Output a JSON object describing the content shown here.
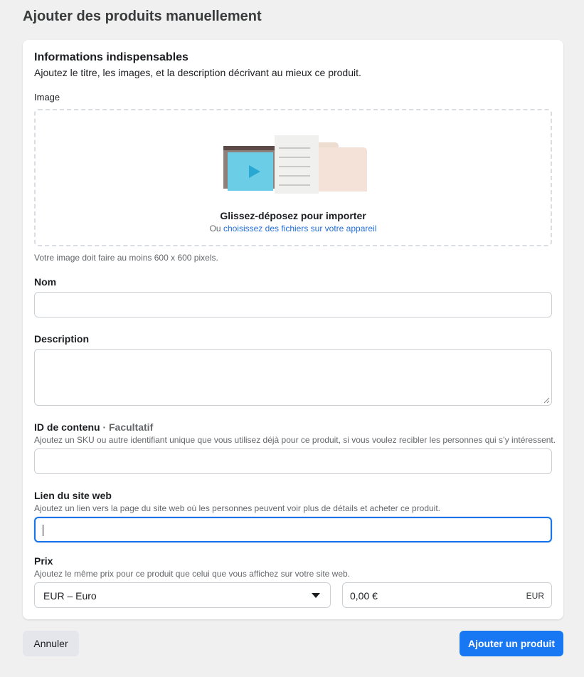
{
  "page": {
    "title": "Ajouter des produits manuellement"
  },
  "section": {
    "title": "Informations indispensables",
    "subtitle": "Ajoutez le titre, les images, et la description décrivant au mieux ce produit."
  },
  "image": {
    "label": "Image",
    "drop_title": "Glissez-déposez pour importer",
    "drop_or": "Ou",
    "drop_link": "choisissez des fichiers sur votre appareil",
    "helper": "Votre image doit faire au moins 600 x 600 pixels.",
    "illustration_icon": "media-files-illustration"
  },
  "name": {
    "label": "Nom",
    "value": "",
    "placeholder": ""
  },
  "description": {
    "label": "Description",
    "value": ""
  },
  "content_id": {
    "label": "ID de contenu",
    "optional": "· Facultatif",
    "helper": "Ajoutez un SKU ou autre identifiant unique que vous utilisez déjà pour ce produit, si vous voulez recibler les personnes qui s’y intéressent.",
    "value": ""
  },
  "website": {
    "label": "Lien du site web",
    "helper": "Ajoutez un lien vers la page du site web où les personnes peuvent voir plus de détails et acheter ce produit.",
    "value": "",
    "focused": true
  },
  "price": {
    "label": "Prix",
    "helper": "Ajoutez le même prix pour ce produit que celui que vous affichez sur votre site web.",
    "currency_selected": "EUR – Euro",
    "amount": "0,00 €",
    "unit": "EUR"
  },
  "actions": {
    "cancel": "Annuler",
    "submit": "Ajouter un produit"
  },
  "colors": {
    "primary": "#1877f2",
    "focus": "#1a73e8",
    "link": "#216fdb",
    "background": "#f0f0f0"
  }
}
